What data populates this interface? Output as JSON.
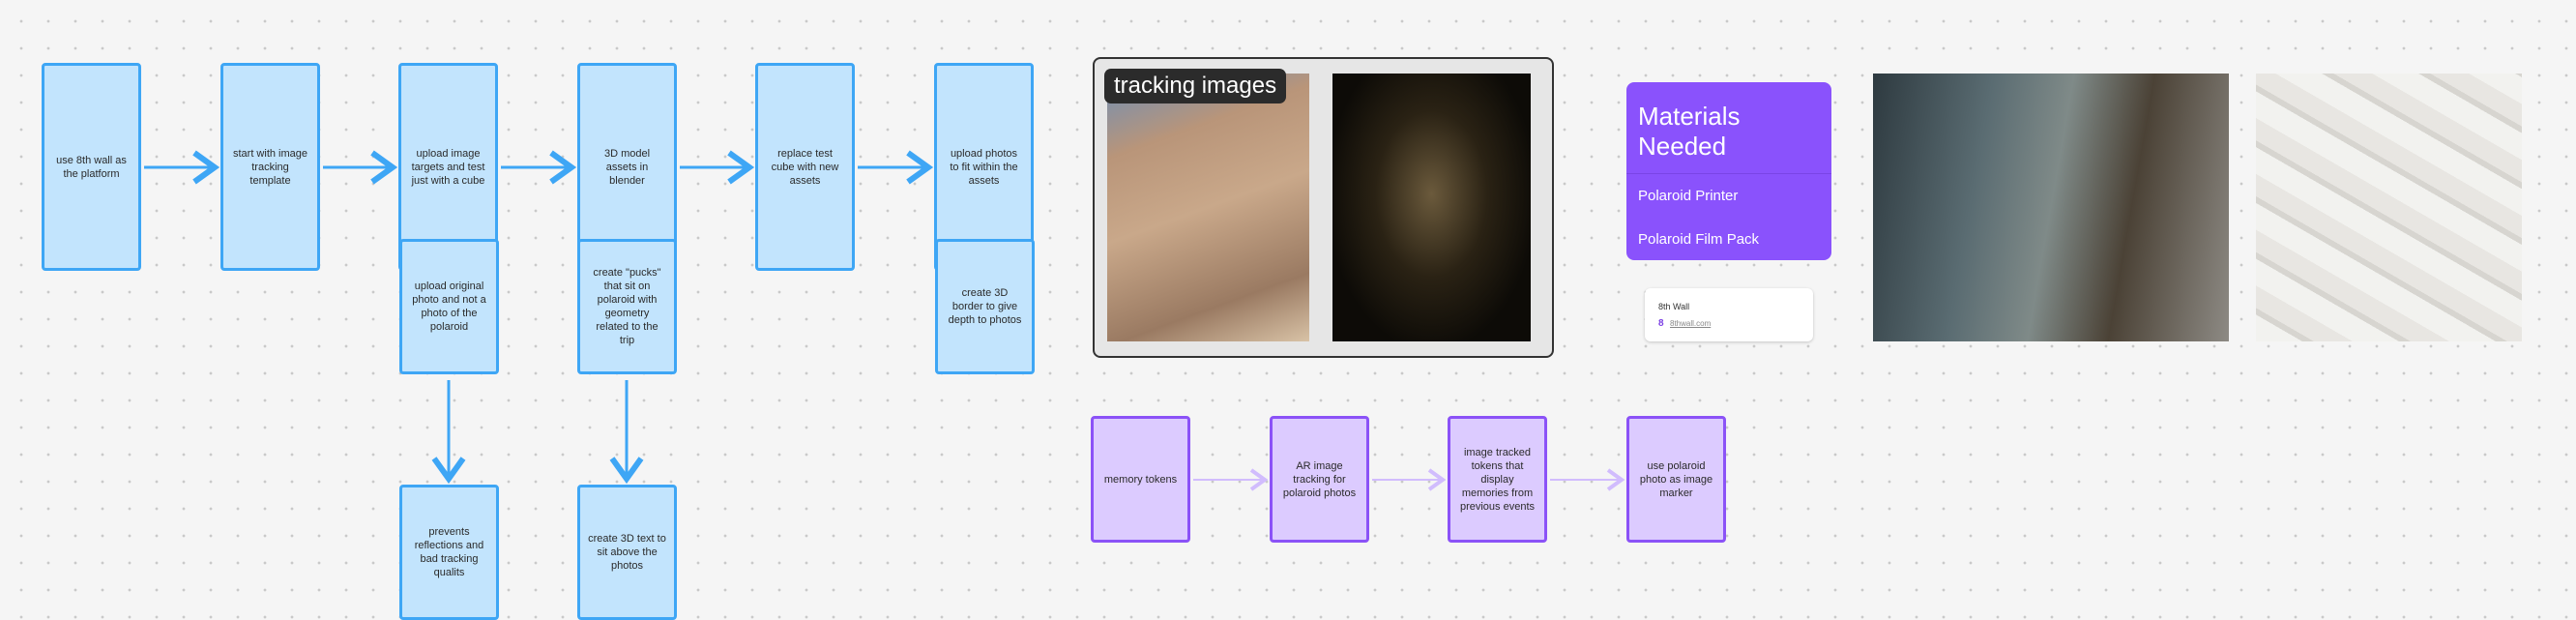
{
  "flow_blue": {
    "row1": [
      "use 8th wall as the platform",
      "start with image tracking template",
      "upload image targets and test just with a cube",
      "3D model assets in blender",
      "replace test cube with new assets",
      "upload photos to fit within the assets"
    ],
    "row2": [
      "upload original photo and not a photo of the polaroid",
      "create \"pucks\" that sit on polaroid with geometry related to the trip",
      "create 3D border to give depth to photos"
    ],
    "row3": [
      "prevents reflections and bad tracking qualits",
      "create 3D text to sit above the photos"
    ]
  },
  "flow_purple": [
    "memory tokens",
    "AR image tracking for polaroid photos",
    "image tracked tokens that display memories from previous events",
    "use polaroid photo as image marker"
  ],
  "tracking": {
    "label": "tracking images"
  },
  "materials": {
    "title": "Materials Needed",
    "items": [
      "Polaroid Printer",
      "Polaroid Film Pack"
    ]
  },
  "link_card": {
    "title": "8th Wall",
    "url": "8thwall.com",
    "icon": "8"
  },
  "colors": {
    "blue_fill": "#c2e4fd",
    "blue_border": "#3ea6f5",
    "purple_fill": "#dccbff",
    "purple_border": "#8b52f7",
    "materials": "#8a52fc"
  }
}
